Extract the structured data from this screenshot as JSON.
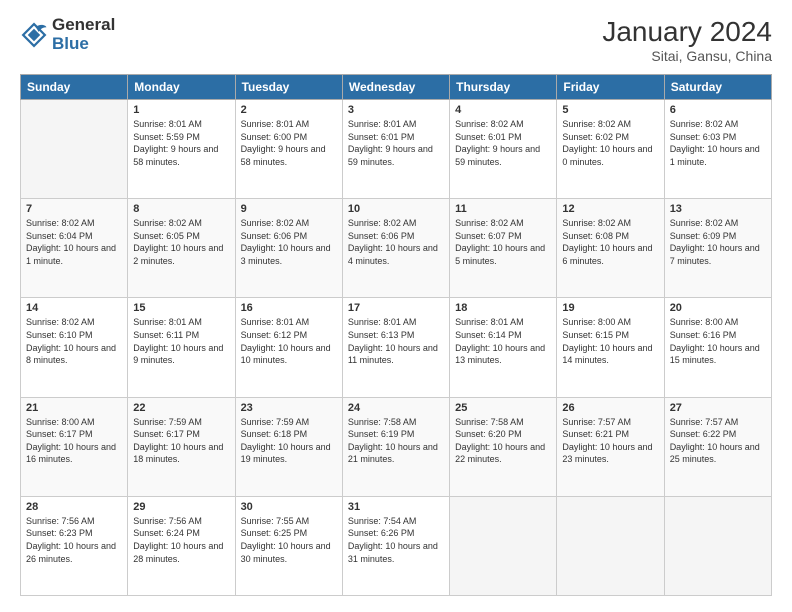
{
  "logo": {
    "line1": "General",
    "line2": "Blue"
  },
  "title": "January 2024",
  "subtitle": "Sitai, Gansu, China",
  "weekdays": [
    "Sunday",
    "Monday",
    "Tuesday",
    "Wednesday",
    "Thursday",
    "Friday",
    "Saturday"
  ],
  "weeks": [
    [
      {
        "day": "",
        "sunrise": "",
        "sunset": "",
        "daylight": ""
      },
      {
        "day": "1",
        "sunrise": "Sunrise: 8:01 AM",
        "sunset": "Sunset: 5:59 PM",
        "daylight": "Daylight: 9 hours and 58 minutes."
      },
      {
        "day": "2",
        "sunrise": "Sunrise: 8:01 AM",
        "sunset": "Sunset: 6:00 PM",
        "daylight": "Daylight: 9 hours and 58 minutes."
      },
      {
        "day": "3",
        "sunrise": "Sunrise: 8:01 AM",
        "sunset": "Sunset: 6:01 PM",
        "daylight": "Daylight: 9 hours and 59 minutes."
      },
      {
        "day": "4",
        "sunrise": "Sunrise: 8:02 AM",
        "sunset": "Sunset: 6:01 PM",
        "daylight": "Daylight: 9 hours and 59 minutes."
      },
      {
        "day": "5",
        "sunrise": "Sunrise: 8:02 AM",
        "sunset": "Sunset: 6:02 PM",
        "daylight": "Daylight: 10 hours and 0 minutes."
      },
      {
        "day": "6",
        "sunrise": "Sunrise: 8:02 AM",
        "sunset": "Sunset: 6:03 PM",
        "daylight": "Daylight: 10 hours and 1 minute."
      }
    ],
    [
      {
        "day": "7",
        "sunrise": "Sunrise: 8:02 AM",
        "sunset": "Sunset: 6:04 PM",
        "daylight": "Daylight: 10 hours and 1 minute."
      },
      {
        "day": "8",
        "sunrise": "Sunrise: 8:02 AM",
        "sunset": "Sunset: 6:05 PM",
        "daylight": "Daylight: 10 hours and 2 minutes."
      },
      {
        "day": "9",
        "sunrise": "Sunrise: 8:02 AM",
        "sunset": "Sunset: 6:06 PM",
        "daylight": "Daylight: 10 hours and 3 minutes."
      },
      {
        "day": "10",
        "sunrise": "Sunrise: 8:02 AM",
        "sunset": "Sunset: 6:06 PM",
        "daylight": "Daylight: 10 hours and 4 minutes."
      },
      {
        "day": "11",
        "sunrise": "Sunrise: 8:02 AM",
        "sunset": "Sunset: 6:07 PM",
        "daylight": "Daylight: 10 hours and 5 minutes."
      },
      {
        "day": "12",
        "sunrise": "Sunrise: 8:02 AM",
        "sunset": "Sunset: 6:08 PM",
        "daylight": "Daylight: 10 hours and 6 minutes."
      },
      {
        "day": "13",
        "sunrise": "Sunrise: 8:02 AM",
        "sunset": "Sunset: 6:09 PM",
        "daylight": "Daylight: 10 hours and 7 minutes."
      }
    ],
    [
      {
        "day": "14",
        "sunrise": "Sunrise: 8:02 AM",
        "sunset": "Sunset: 6:10 PM",
        "daylight": "Daylight: 10 hours and 8 minutes."
      },
      {
        "day": "15",
        "sunrise": "Sunrise: 8:01 AM",
        "sunset": "Sunset: 6:11 PM",
        "daylight": "Daylight: 10 hours and 9 minutes."
      },
      {
        "day": "16",
        "sunrise": "Sunrise: 8:01 AM",
        "sunset": "Sunset: 6:12 PM",
        "daylight": "Daylight: 10 hours and 10 minutes."
      },
      {
        "day": "17",
        "sunrise": "Sunrise: 8:01 AM",
        "sunset": "Sunset: 6:13 PM",
        "daylight": "Daylight: 10 hours and 11 minutes."
      },
      {
        "day": "18",
        "sunrise": "Sunrise: 8:01 AM",
        "sunset": "Sunset: 6:14 PM",
        "daylight": "Daylight: 10 hours and 13 minutes."
      },
      {
        "day": "19",
        "sunrise": "Sunrise: 8:00 AM",
        "sunset": "Sunset: 6:15 PM",
        "daylight": "Daylight: 10 hours and 14 minutes."
      },
      {
        "day": "20",
        "sunrise": "Sunrise: 8:00 AM",
        "sunset": "Sunset: 6:16 PM",
        "daylight": "Daylight: 10 hours and 15 minutes."
      }
    ],
    [
      {
        "day": "21",
        "sunrise": "Sunrise: 8:00 AM",
        "sunset": "Sunset: 6:17 PM",
        "daylight": "Daylight: 10 hours and 16 minutes."
      },
      {
        "day": "22",
        "sunrise": "Sunrise: 7:59 AM",
        "sunset": "Sunset: 6:17 PM",
        "daylight": "Daylight: 10 hours and 18 minutes."
      },
      {
        "day": "23",
        "sunrise": "Sunrise: 7:59 AM",
        "sunset": "Sunset: 6:18 PM",
        "daylight": "Daylight: 10 hours and 19 minutes."
      },
      {
        "day": "24",
        "sunrise": "Sunrise: 7:58 AM",
        "sunset": "Sunset: 6:19 PM",
        "daylight": "Daylight: 10 hours and 21 minutes."
      },
      {
        "day": "25",
        "sunrise": "Sunrise: 7:58 AM",
        "sunset": "Sunset: 6:20 PM",
        "daylight": "Daylight: 10 hours and 22 minutes."
      },
      {
        "day": "26",
        "sunrise": "Sunrise: 7:57 AM",
        "sunset": "Sunset: 6:21 PM",
        "daylight": "Daylight: 10 hours and 23 minutes."
      },
      {
        "day": "27",
        "sunrise": "Sunrise: 7:57 AM",
        "sunset": "Sunset: 6:22 PM",
        "daylight": "Daylight: 10 hours and 25 minutes."
      }
    ],
    [
      {
        "day": "28",
        "sunrise": "Sunrise: 7:56 AM",
        "sunset": "Sunset: 6:23 PM",
        "daylight": "Daylight: 10 hours and 26 minutes."
      },
      {
        "day": "29",
        "sunrise": "Sunrise: 7:56 AM",
        "sunset": "Sunset: 6:24 PM",
        "daylight": "Daylight: 10 hours and 28 minutes."
      },
      {
        "day": "30",
        "sunrise": "Sunrise: 7:55 AM",
        "sunset": "Sunset: 6:25 PM",
        "daylight": "Daylight: 10 hours and 30 minutes."
      },
      {
        "day": "31",
        "sunrise": "Sunrise: 7:54 AM",
        "sunset": "Sunset: 6:26 PM",
        "daylight": "Daylight: 10 hours and 31 minutes."
      },
      {
        "day": "",
        "sunrise": "",
        "sunset": "",
        "daylight": ""
      },
      {
        "day": "",
        "sunrise": "",
        "sunset": "",
        "daylight": ""
      },
      {
        "day": "",
        "sunrise": "",
        "sunset": "",
        "daylight": ""
      }
    ]
  ]
}
